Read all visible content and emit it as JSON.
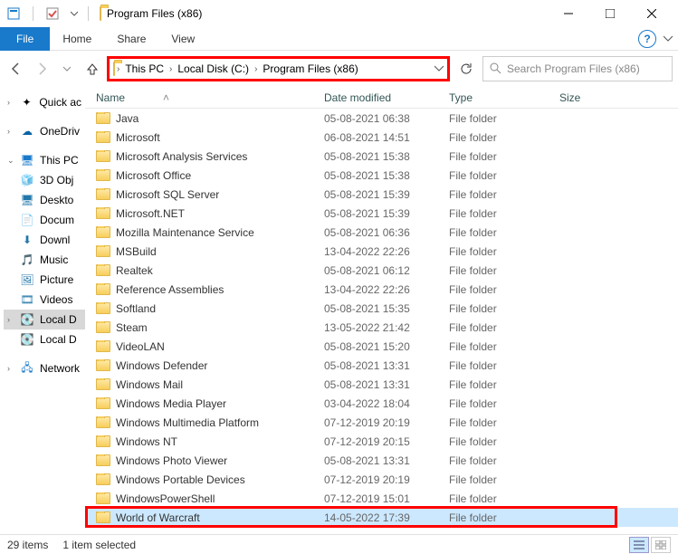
{
  "window": {
    "title": "Program Files (x86)"
  },
  "ribbon": {
    "file": "File",
    "home": "Home",
    "share": "Share",
    "view": "View"
  },
  "breadcrumb": {
    "pc": "This PC",
    "drive": "Local Disk (C:)",
    "folder": "Program Files (x86)"
  },
  "search": {
    "placeholder": "Search Program Files (x86)"
  },
  "columns": {
    "name": "Name",
    "date": "Date modified",
    "type": "Type",
    "size": "Size"
  },
  "sidebar": {
    "quick": "Quick ac",
    "onedrive": "OneDriv",
    "thispc": "This PC",
    "items": [
      "3D Obj",
      "Deskto",
      "Docum",
      "Downl",
      "Music",
      "Picture",
      "Videos",
      "Local D",
      "Local D"
    ],
    "network": "Network"
  },
  "rows": [
    {
      "name": "Java",
      "date": "05-08-2021 06:38",
      "type": "File folder"
    },
    {
      "name": "Microsoft",
      "date": "06-08-2021 14:51",
      "type": "File folder"
    },
    {
      "name": "Microsoft Analysis Services",
      "date": "05-08-2021 15:38",
      "type": "File folder"
    },
    {
      "name": "Microsoft Office",
      "date": "05-08-2021 15:38",
      "type": "File folder"
    },
    {
      "name": "Microsoft SQL Server",
      "date": "05-08-2021 15:39",
      "type": "File folder"
    },
    {
      "name": "Microsoft.NET",
      "date": "05-08-2021 15:39",
      "type": "File folder"
    },
    {
      "name": "Mozilla Maintenance Service",
      "date": "05-08-2021 06:36",
      "type": "File folder"
    },
    {
      "name": "MSBuild",
      "date": "13-04-2022 22:26",
      "type": "File folder"
    },
    {
      "name": "Realtek",
      "date": "05-08-2021 06:12",
      "type": "File folder"
    },
    {
      "name": "Reference Assemblies",
      "date": "13-04-2022 22:26",
      "type": "File folder"
    },
    {
      "name": "Softland",
      "date": "05-08-2021 15:35",
      "type": "File folder"
    },
    {
      "name": "Steam",
      "date": "13-05-2022 21:42",
      "type": "File folder"
    },
    {
      "name": "VideoLAN",
      "date": "05-08-2021 15:20",
      "type": "File folder"
    },
    {
      "name": "Windows Defender",
      "date": "05-08-2021 13:31",
      "type": "File folder"
    },
    {
      "name": "Windows Mail",
      "date": "05-08-2021 13:31",
      "type": "File folder"
    },
    {
      "name": "Windows Media Player",
      "date": "03-04-2022 18:04",
      "type": "File folder"
    },
    {
      "name": "Windows Multimedia Platform",
      "date": "07-12-2019 20:19",
      "type": "File folder"
    },
    {
      "name": "Windows NT",
      "date": "07-12-2019 20:15",
      "type": "File folder"
    },
    {
      "name": "Windows Photo Viewer",
      "date": "05-08-2021 13:31",
      "type": "File folder"
    },
    {
      "name": "Windows Portable Devices",
      "date": "07-12-2019 20:19",
      "type": "File folder"
    },
    {
      "name": "WindowsPowerShell",
      "date": "07-12-2019 15:01",
      "type": "File folder"
    },
    {
      "name": "World of Warcraft",
      "date": "14-05-2022 17:39",
      "type": "File folder",
      "selected": true
    }
  ],
  "status": {
    "count": "29 items",
    "selection": "1 item selected"
  }
}
